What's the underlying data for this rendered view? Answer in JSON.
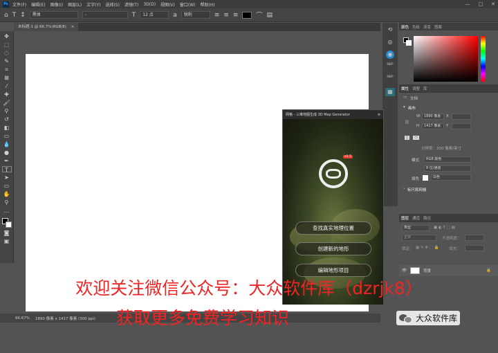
{
  "menubar": {
    "items": [
      "文件(F)",
      "编辑(E)",
      "图像(I)",
      "图层(L)",
      "文字(Y)",
      "选择(S)",
      "滤镜(T)",
      "3D(D)",
      "视图(V)",
      "窗口(W)",
      "帮助(H)"
    ],
    "logo": "Ps"
  },
  "window_controls": {
    "minimize": "—",
    "maximize": "□",
    "close": "✕"
  },
  "options": {
    "font_family": "黑体",
    "font_style": "-",
    "font_size": "12 点",
    "antialias": "锐利"
  },
  "document_tab": {
    "label": "未标题-1 @ 66.7%(RGB/8)",
    "close": "×"
  },
  "status": {
    "zoom": "66.67%",
    "doc_info": "1890 像素 x 1417 像素 (300 ppi)"
  },
  "midstrip": {
    "label_a": "NBP",
    "label_b": "NBP"
  },
  "color_panel": {
    "tabs": [
      "颜色",
      "色板",
      "渐变",
      "图案"
    ]
  },
  "properties_panel": {
    "tabs": [
      "属性",
      "调整",
      "库"
    ],
    "doc_label": "文档",
    "section_canvas": "画布",
    "w_label": "W",
    "w_value": "1890 像素",
    "x_label": "X",
    "h_label": "H",
    "h_value": "1417 像素",
    "y_label": "Y",
    "resolution": "分辨率：300 像素/英寸",
    "mode_label": "模式",
    "mode_value": "RGB 颜色",
    "depth_value": "8 位/通道",
    "fill_label": "填色",
    "fill_value": "白色",
    "section_rulers": "标尺和网格"
  },
  "layers_panel": {
    "tabs": [
      "图层",
      "通道",
      "路径"
    ],
    "kind_filter": "类型",
    "blend_mode": "正常",
    "opacity_label": "不透明度：",
    "lock_label": "锁定：",
    "fill_label": "填充：",
    "layer_name": "背景"
  },
  "plugin": {
    "title": "网格 - 三维地图生成 3D Map Generator",
    "version": "v1.5",
    "btn_find": "查找真实地理位置",
    "btn_create": "创建新的地形",
    "btn_edit": "编辑地形项目"
  },
  "watermark": {
    "line1": "欢迎关注微信公众号：大众软件库（dzrjk8）",
    "line2": "获取更多免费学习知识",
    "wechat_name": "大众软件库"
  }
}
